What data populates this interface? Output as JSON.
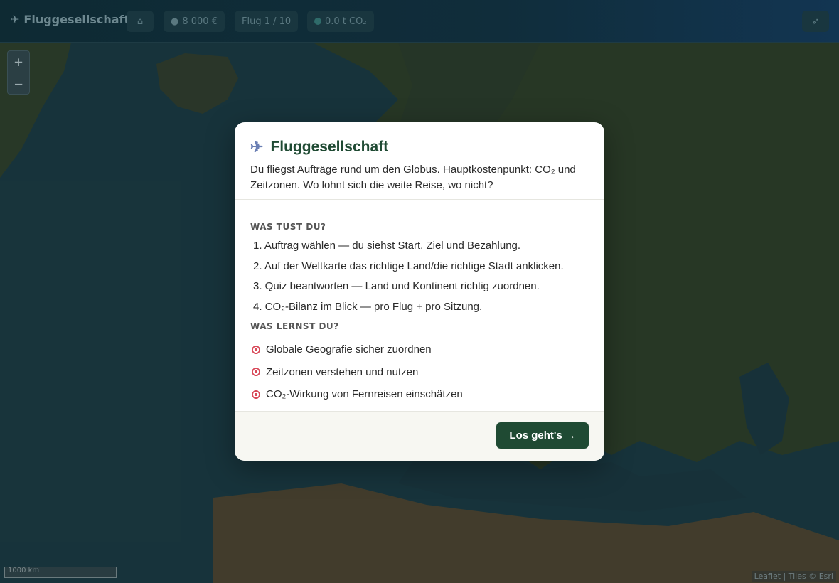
{
  "topbar": {
    "brand": "Fluggesellschaft",
    "money": "8 000 €",
    "flight": "Flug 1 / 10",
    "co2": "0.0 t CO₂"
  },
  "map": {
    "zoom_in": "+",
    "zoom_out": "−",
    "scale": "1000 km",
    "attribution": "Leaflet | Tiles © Esri"
  },
  "modal": {
    "title": "Fluggesellschaft",
    "subtitle": "Du fliegst Aufträge rund um den Globus. Hauptkostenpunkt: CO₂ und Zeitzonen. Wo lohnt sich die weite Reise, wo nicht?",
    "section1_title": "WAS TUST DU?",
    "steps": [
      "1. Auftrag wählen — du siehst Start, Ziel und Bezahlung.",
      "2. Auf der Weltkarte das richtige Land/die richtige Stadt anklicken.",
      "3. Quiz beantworten — Land und Kontinent richtig zuordnen.",
      "4. CO₂-Bilanz im Blick — pro Flug + pro Sitzung."
    ],
    "section2_title": "WAS LERNST DU?",
    "goals": [
      "Globale Geografie sicher zuordnen",
      "Zeitzonen verstehen und nutzen",
      "CO₂-Wirkung von Fernreisen einschätzen"
    ],
    "button": "Los geht's →"
  },
  "colors": {
    "accent": "#1f4a33",
    "overlay": "#0e2a33"
  }
}
